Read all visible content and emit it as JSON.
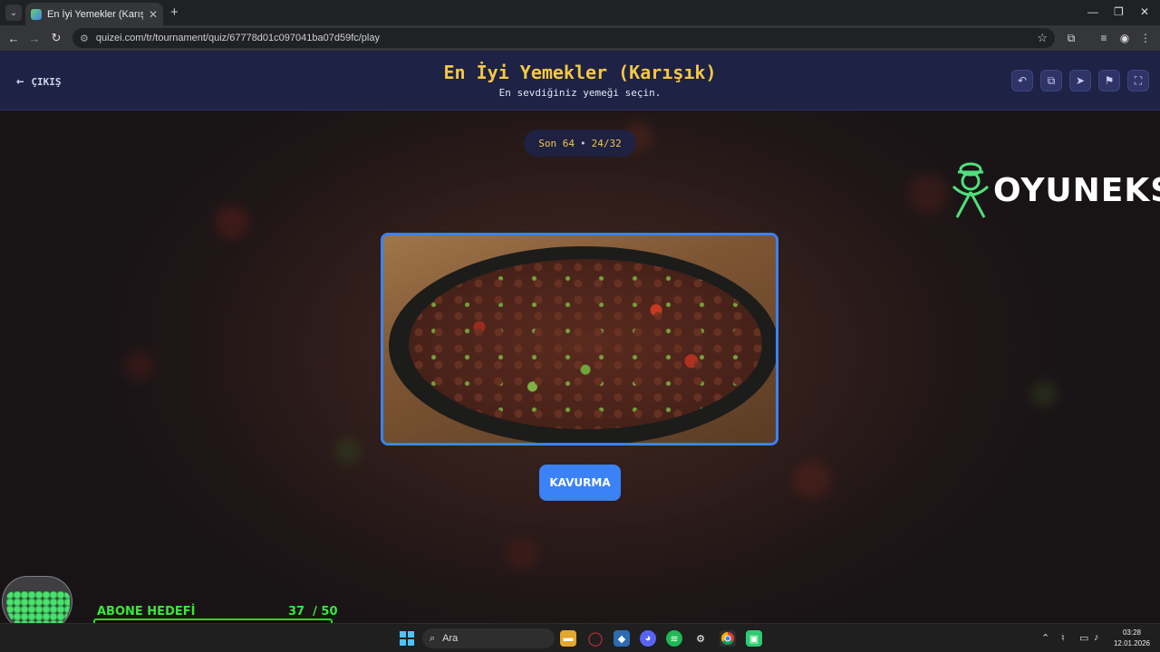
{
  "browser": {
    "tab_title": "En İyi Yemekler (Karışık) - Tier Li",
    "url": "quizei.com/tr/tournament/quiz/67778d01c097041ba07d59fc/play"
  },
  "header": {
    "exit_label": "ÇIKIŞ",
    "title": "En İyi Yemekler (Karışık)",
    "subtitle": "En sevdiğiniz yemeği seçin."
  },
  "round": {
    "stage": "Son 64",
    "separator": "•",
    "progress": "24/32"
  },
  "brand": {
    "name": "OYUNEKS",
    "color": "#4ee07a"
  },
  "choice": {
    "label": "KAVURMA"
  },
  "overlay": {
    "label": "ABONE HEDEFİ",
    "current": "37",
    "goal": "/ 50",
    "progress_fraction": 0.74
  },
  "taskbar": {
    "search_placeholder": "Ara",
    "time": "03:28",
    "date": "12.01.2026"
  },
  "colors": {
    "accent": "#3b82f6",
    "title": "#f5c842",
    "header_bg": "#1e2245"
  }
}
